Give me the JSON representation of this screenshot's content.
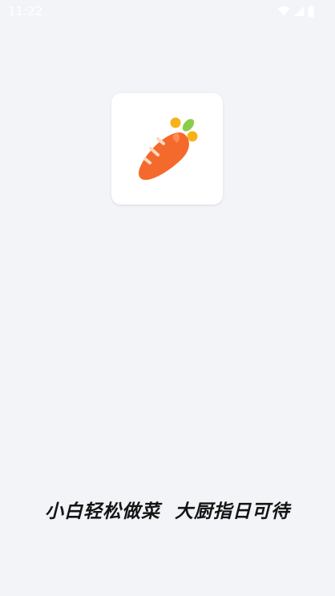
{
  "status_bar": {
    "time": "11:22",
    "icons": [
      "wifi-icon",
      "signal-icon",
      "battery-icon"
    ],
    "color": "#ffffff"
  },
  "app_icon": {
    "icon": "carrot-icon",
    "colors": {
      "body": "#f46a2c",
      "highlight": "#ff8a54",
      "stripes": "#ffd9c4",
      "leaf_green": "#8ccc4a",
      "leaf_yellow": "#f7b21b"
    }
  },
  "slogan": {
    "text": "小白轻松做菜  大厨指日可待"
  },
  "theme": {
    "background": "#f3f4f8"
  }
}
